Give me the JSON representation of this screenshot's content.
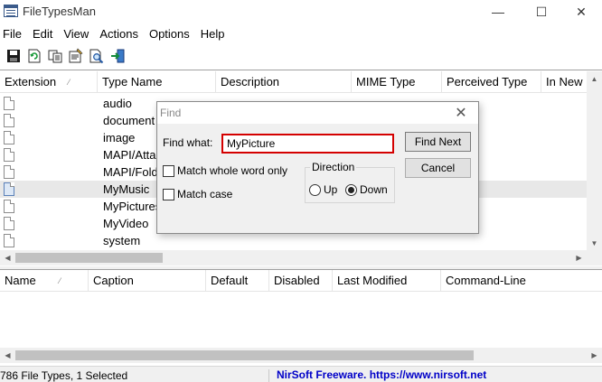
{
  "window": {
    "title": "FileTypesMan",
    "minimize_glyph": "—",
    "maximize_glyph": "☐",
    "close_glyph": "✕"
  },
  "menu": [
    "File",
    "Edit",
    "View",
    "Actions",
    "Options",
    "Help"
  ],
  "toolbar": {
    "buttons": [
      "save-icon",
      "refresh-icon",
      "copy-icon",
      "properties-icon",
      "find-icon",
      "exit-icon"
    ]
  },
  "upper_table": {
    "columns": [
      "Extension",
      "Type Name",
      "Description",
      "MIME Type",
      "Perceived Type",
      "In New M"
    ],
    "sort_glyph": "⁄",
    "rows": [
      {
        "type_name": "audio"
      },
      {
        "type_name": "document"
      },
      {
        "type_name": "image"
      },
      {
        "type_name": "MAPI/Attachment"
      },
      {
        "type_name": "MAPI/Folder"
      },
      {
        "type_name": "MyMusic"
      },
      {
        "type_name": "MyPictures"
      },
      {
        "type_name": "MyVideo"
      },
      {
        "type_name": "system"
      }
    ],
    "selected_row": 5
  },
  "lower_table": {
    "columns": [
      "Name",
      "Caption",
      "Default",
      "Disabled",
      "Last Modified",
      "Command-Line"
    ]
  },
  "status": {
    "left": "786 File Types, 1 Selected",
    "link": "NirSoft Freeware. https://www.nirsoft.net"
  },
  "find_dialog": {
    "title": "Find",
    "find_what_label": "Find what:",
    "find_value": "MyPicture",
    "find_next_label": "Find Next",
    "cancel_label": "Cancel",
    "match_whole_word_label": "Match whole word only",
    "match_case_label": "Match case",
    "direction_label": "Direction",
    "up_label": "Up",
    "down_label": "Down",
    "direction_selected": "Down",
    "close_glyph": "✕"
  },
  "colors": {
    "highlight_border": "#d40000",
    "link": "#0000c8",
    "selected_row": "#e8e8e8"
  }
}
